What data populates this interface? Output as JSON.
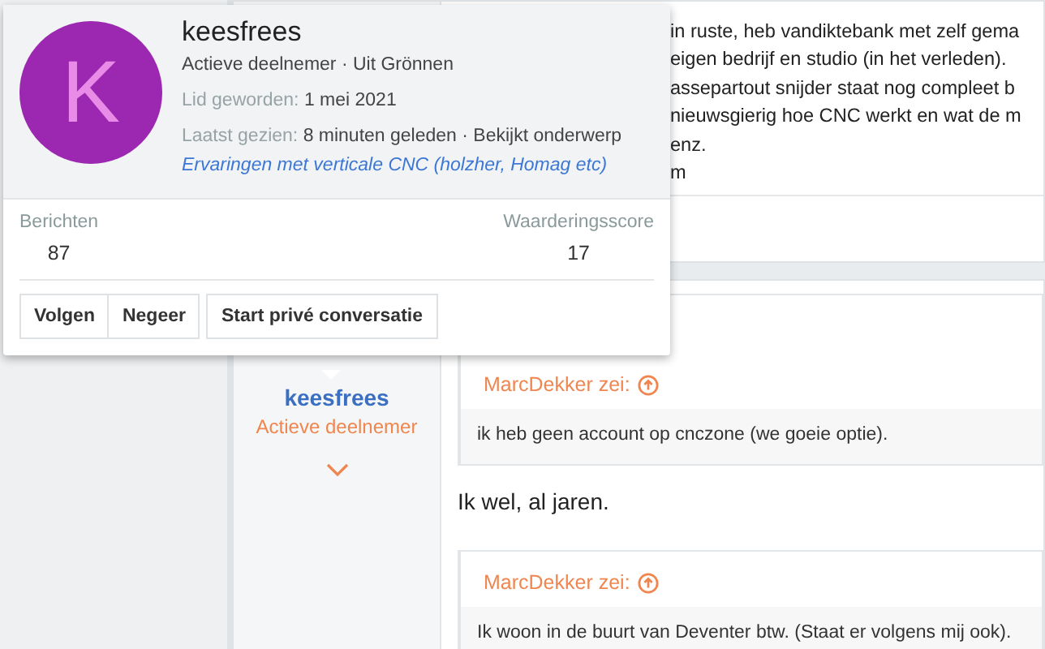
{
  "profile_card": {
    "avatar_letter": "K",
    "name": "keesfrees",
    "subtitle": "Actieve deelnemer · Uit Grönnen",
    "joined": {
      "label": "Lid geworden:",
      "value": "1 mei 2021"
    },
    "last_seen": {
      "label": "Laatst gezien:",
      "value": "8 minuten geleden · Bekijkt onderwerp"
    },
    "thread_link": "Ervaringen met verticale CNC (holzher, Homag etc)",
    "stats": [
      {
        "label": "Berichten",
        "value": "87"
      },
      {
        "label": "Waarderingsscore",
        "value": "17"
      }
    ],
    "buttons": [
      "Volgen",
      "Negeer",
      "Start privé conversatie"
    ]
  },
  "post_above": {
    "lines": [
      "in ruste, heb vandiktebank met zelf gema",
      "eigen bedrijf en studio (in het verleden).",
      "assepartout snijder staat nog compleet b",
      "nieuwsgierig hoe CNC werkt en wat de m",
      "enz.",
      "m"
    ]
  },
  "post": {
    "author": {
      "name": "keesfrees",
      "title": "Actieve deelnemer"
    },
    "content": [
      {
        "kind": "quote",
        "author": "MarcDekker zei:",
        "text": "ik heb geen account op cnczone (we goeie optie)."
      },
      {
        "kind": "text",
        "text": "Ik wel, al jaren."
      },
      {
        "kind": "quote",
        "author": "MarcDekker zei:",
        "text": "Ik woon in de buurt van Deventer btw. (Staat er volgens mij ook)."
      }
    ]
  }
}
